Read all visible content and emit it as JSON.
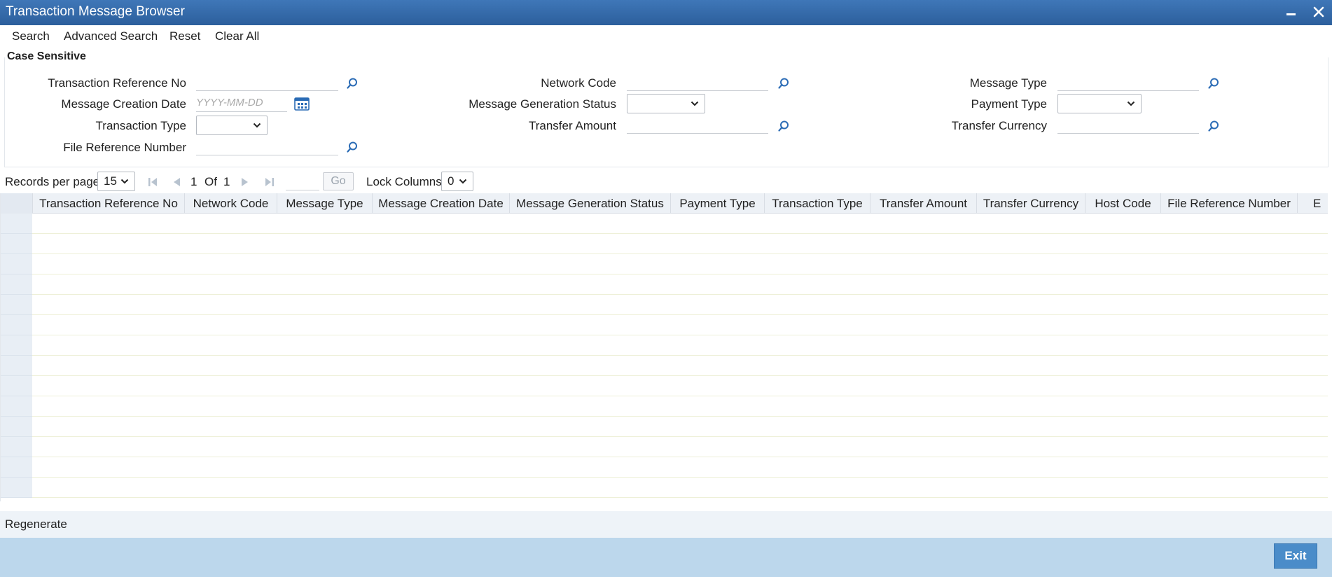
{
  "window": {
    "title": "Transaction Message Browser"
  },
  "toolbar": {
    "search": "Search",
    "advanced_search": "Advanced Search",
    "reset": "Reset",
    "clear_all": "Clear All"
  },
  "search_panel": {
    "legend": "Case Sensitive",
    "fields": {
      "transaction_reference_no": {
        "label": "Transaction Reference No",
        "value": ""
      },
      "network_code": {
        "label": "Network Code",
        "value": ""
      },
      "message_type": {
        "label": "Message Type",
        "value": ""
      },
      "message_creation_date": {
        "label": "Message Creation Date",
        "value": "",
        "placeholder": "YYYY-MM-DD"
      },
      "message_generation_status": {
        "label": "Message Generation Status",
        "value": ""
      },
      "payment_type": {
        "label": "Payment Type",
        "value": ""
      },
      "transaction_type": {
        "label": "Transaction Type",
        "value": ""
      },
      "transfer_amount": {
        "label": "Transfer Amount",
        "value": ""
      },
      "transfer_currency": {
        "label": "Transfer Currency",
        "value": ""
      },
      "file_reference_number": {
        "label": "File Reference Number",
        "value": ""
      }
    }
  },
  "pager": {
    "records_per_page_label": "Records per page",
    "records_per_page": "15",
    "current_page": "1",
    "of_label": "Of",
    "total_pages": "1",
    "go_label": "Go",
    "lock_columns_label": "Lock Columns",
    "lock_columns": "0"
  },
  "grid": {
    "columns": [
      "Transaction Reference No",
      "Network Code",
      "Message Type",
      "Message Creation Date",
      "Message Generation Status",
      "Payment Type",
      "Transaction Type",
      "Transfer Amount",
      "Transfer Currency",
      "Host Code",
      "File Reference Number",
      "E"
    ],
    "rows": []
  },
  "footer": {
    "regenerate": "Regenerate",
    "exit": "Exit"
  },
  "colors": {
    "title_bar": "#2c5f9c",
    "icon_blue": "#2a6bb5",
    "exit_button": "#4a8cc9",
    "bottom_bar": "#bcd7ec"
  }
}
